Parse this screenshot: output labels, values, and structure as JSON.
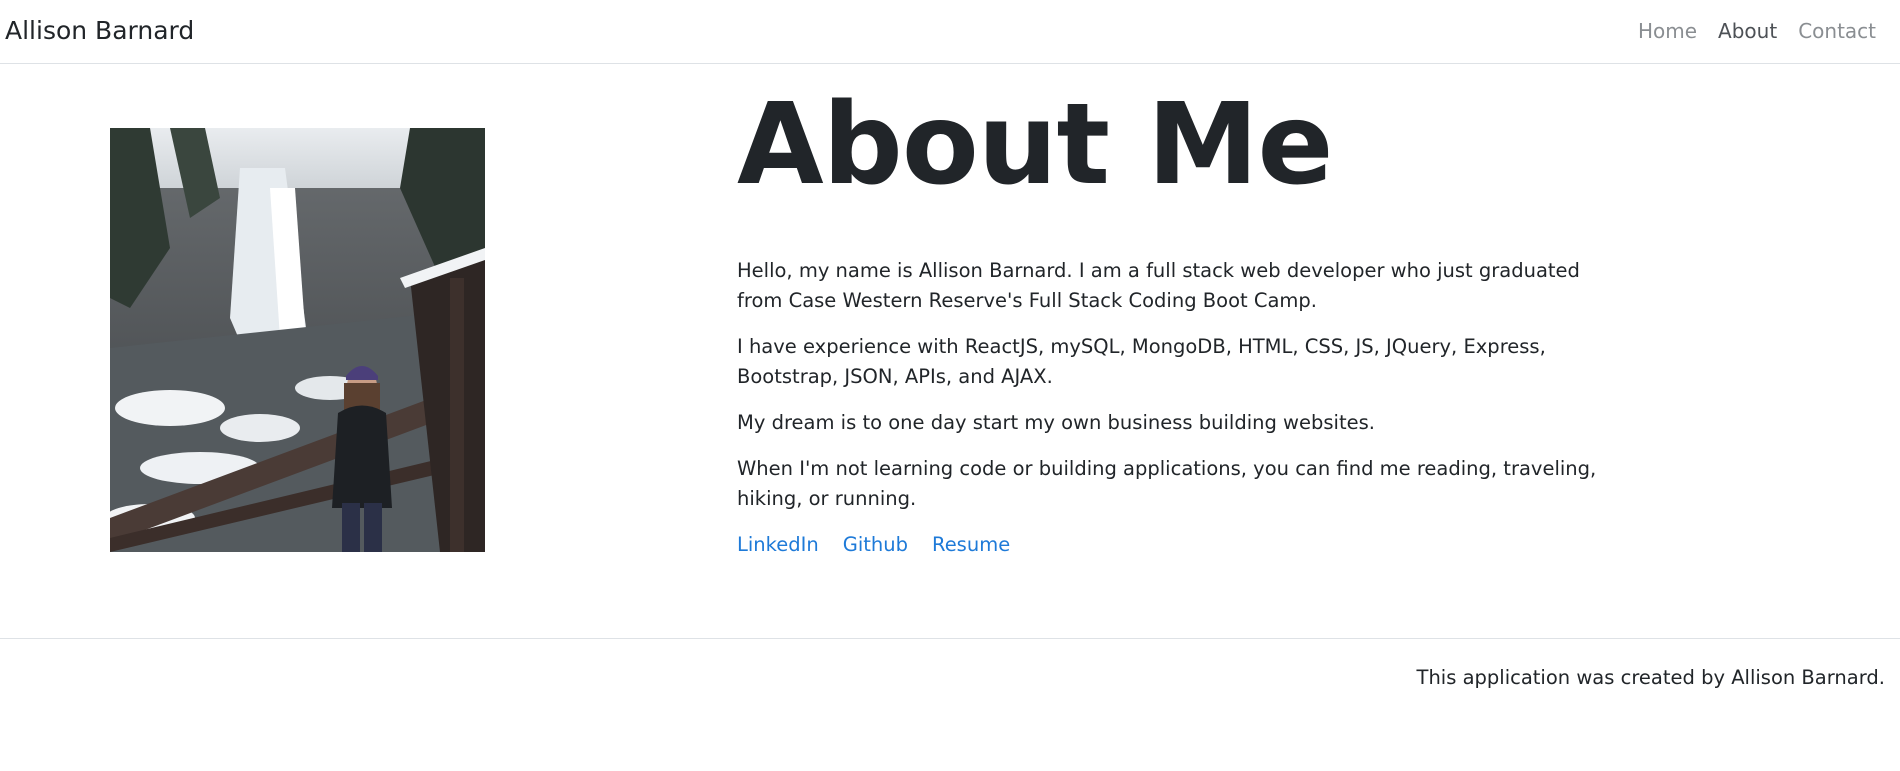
{
  "navbar": {
    "brand": "Allison Barnard",
    "links": [
      {
        "label": "Home",
        "active": false
      },
      {
        "label": "About",
        "active": true
      },
      {
        "label": "Contact",
        "active": false
      }
    ]
  },
  "main": {
    "heading": "About Me",
    "paragraphs": [
      "Hello, my name is Allison Barnard. I am a full stack web developer who just graduated from Case Western Reserve's Full Stack Coding Boot Camp.",
      "I have experience with ReactJS, mySQL, MongoDB, HTML, CSS, JS, JQuery, Express, Bootstrap, JSON, APIs, and AJAX.",
      "My dream is to one day start my own business building websites.",
      "When I'm not learning code or building applications, you can find me reading, traveling, hiking, or running."
    ],
    "links": [
      "LinkedIn",
      "Github",
      "Resume"
    ]
  },
  "footer": {
    "text": "This application was created by Allison Barnard."
  },
  "colors": {
    "link": "#1e7ad8",
    "text": "#212529",
    "nav_inactive": "#8a8e92",
    "nav_active": "#4d5156",
    "border": "#dee2e6"
  }
}
